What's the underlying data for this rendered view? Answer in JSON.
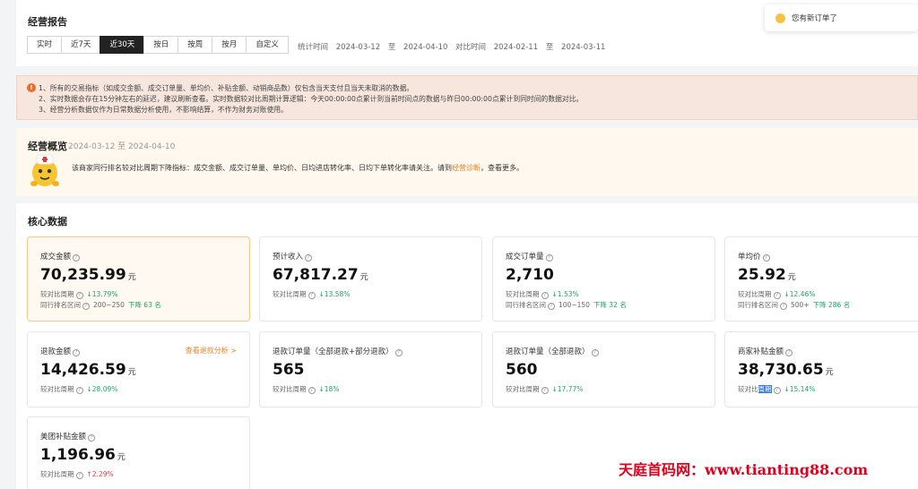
{
  "report": {
    "title": "经营报告",
    "tabs": [
      {
        "label": "实时",
        "active": false
      },
      {
        "label": "近7天",
        "active": false
      },
      {
        "label": "近30天",
        "active": true
      },
      {
        "label": "按日",
        "active": false
      },
      {
        "label": "按周",
        "active": false
      },
      {
        "label": "按月",
        "active": false
      },
      {
        "label": "自定义",
        "active": false
      }
    ],
    "stat_label": "统计时间",
    "stat_start": "2024-03-12",
    "stat_to": "至",
    "stat_end": "2024-04-10",
    "cmp_label": "对比时间",
    "cmp_start": "2024-02-11",
    "cmp_to": "至",
    "cmp_end": "2024-03-11"
  },
  "toast": {
    "text": "您有新订单了"
  },
  "notice": {
    "lines": [
      "1、所有的交易指标（如成交金额、成交订单量、单均价、补贴金额、动销商品数）仅包含当天支付且当天未取消的数据。",
      "2、实时数据会存在15分钟左右的延迟，建议刷新查看。实时数据较对比周期计算逻辑：今天00:00:00点累计到当前时间点的数据与昨日00:00:00点累计到同时间的数据对比。",
      "3、经营分析数据仅作为日常数据分析使用，不影响结算，不作为财务对账使用。"
    ]
  },
  "overview": {
    "title": "经营概览",
    "date_range": "2024-03-12 至 2024-04-10",
    "text_before": "该商家同行排名较对比周期下降指标：成交金额、成交订单量、单均价、日均进店转化率、日均下单转化率请关注。请到",
    "link": "经营诊断",
    "text_after": "，查看更多。"
  },
  "core": {
    "title": "核心数据",
    "compare_label": "较对比周期",
    "rank_label": "同行排名区间",
    "unit": "元",
    "cards": [
      {
        "label": "成交金额",
        "value": "70,235.99",
        "unit": "元",
        "change": "↓13.79%",
        "dir": "down",
        "rank": "200~250",
        "rank_change": "下降 63 名",
        "highlight": true
      },
      {
        "label": "预计收入",
        "value": "67,817.27",
        "unit": "元",
        "change": "↓13.58%",
        "dir": "down"
      },
      {
        "label": "成交订单量",
        "value": "2,710",
        "unit": "",
        "change": "↓1.53%",
        "dir": "down",
        "rank": "100~150",
        "rank_change": "下降 32 名"
      },
      {
        "label": "单均价",
        "value": "25.92",
        "unit": "元",
        "change": "↓12.46%",
        "dir": "down",
        "rank": "500+",
        "rank_change": "下降 286 名"
      },
      {
        "label": "退款金额",
        "value": "14,426.59",
        "unit": "元",
        "change": "↓28.09%",
        "dir": "down",
        "link": "查看退款分析 >"
      },
      {
        "label": "退款订单量（全部退款+部分退款）",
        "value": "565",
        "unit": "",
        "change": "↓18%",
        "dir": "down"
      },
      {
        "label": "退款订单量（全部退款）",
        "value": "560",
        "unit": "",
        "change": "↓17.77%",
        "dir": "down"
      },
      {
        "label": "商家补贴金额",
        "value": "38,730.65",
        "unit": "元",
        "change": "↓15.14%",
        "dir": "down",
        "selected": true
      },
      {
        "label": "美团补贴金额",
        "value": "1,196.96",
        "unit": "元",
        "change": "↑2.29%",
        "dir": "up"
      }
    ]
  },
  "watermark": "天庭首码网：www.tianting88.com"
}
